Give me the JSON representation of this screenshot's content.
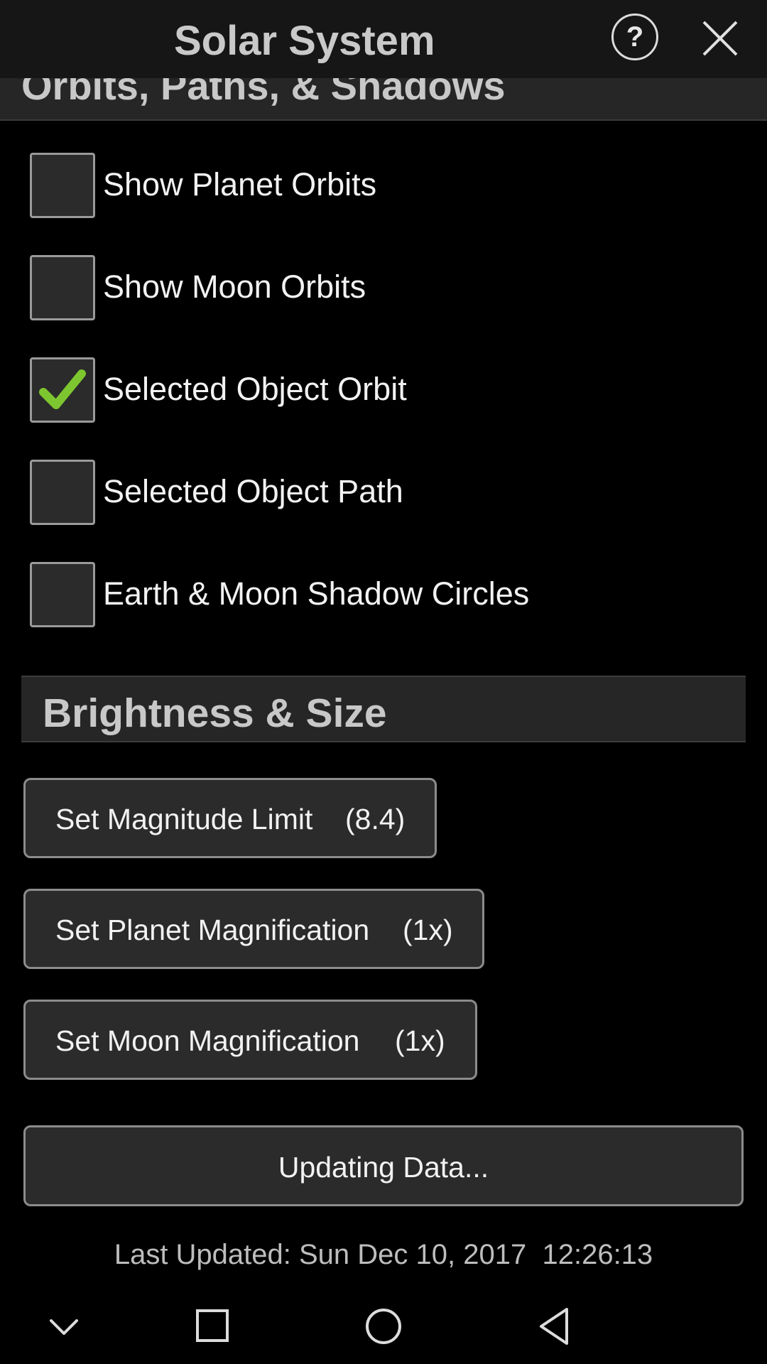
{
  "header": {
    "title": "Solar System",
    "help_glyph": "?"
  },
  "section_orbits": {
    "title": "Orbits, Paths, & Shadows",
    "items": [
      {
        "label": "Show Planet Orbits",
        "checked": false
      },
      {
        "label": "Show Moon Orbits",
        "checked": false
      },
      {
        "label": "Selected Object Orbit",
        "checked": true
      },
      {
        "label": "Selected Object Path",
        "checked": false
      },
      {
        "label": "Earth & Moon Shadow Circles",
        "checked": false
      }
    ]
  },
  "section_brightness": {
    "title": "Brightness & Size",
    "buttons": [
      {
        "label": "Set Magnitude Limit",
        "value": "(8.4)"
      },
      {
        "label": "Set Planet Magnification",
        "value": "(1x)"
      },
      {
        "label": "Set Moon Magnification",
        "value": "(1x)"
      }
    ]
  },
  "update": {
    "button_label": "Updating Data...",
    "last_updated": "Last Updated: Sun Dec 10, 2017  12:26:13"
  },
  "colors": {
    "check_green": "#7dc62f"
  },
  "navbar": {
    "icons": [
      "chevron-down-icon",
      "recents-icon",
      "home-icon",
      "back-icon"
    ]
  }
}
